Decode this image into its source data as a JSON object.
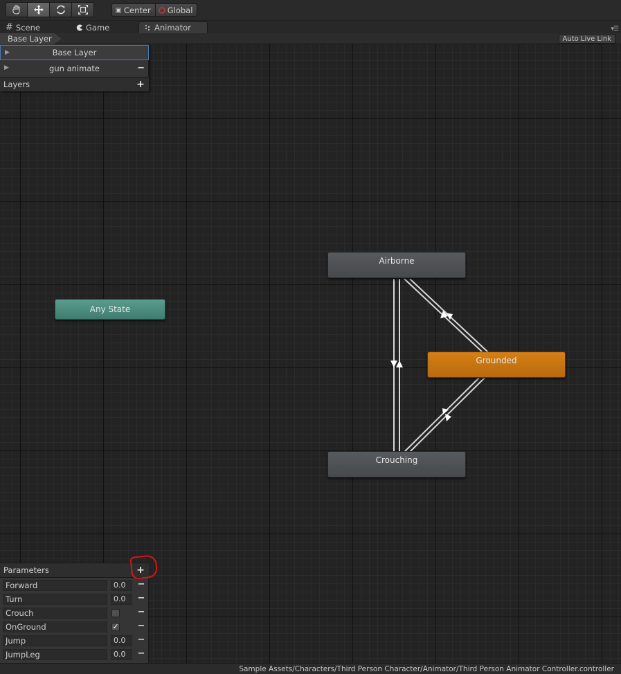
{
  "toolbar": {
    "tools": [
      {
        "name": "hand-icon",
        "glyph": "✋"
      },
      {
        "name": "move-icon",
        "glyph": "✥"
      },
      {
        "name": "rotate-icon",
        "glyph": "⟳"
      },
      {
        "name": "scale-icon",
        "glyph": "⤢"
      }
    ],
    "pivot_label": "Center",
    "space_label": "Global"
  },
  "tabs": {
    "scene": "Scene",
    "game": "Game",
    "animator": "Animator"
  },
  "breadcrumb": "Base Layer",
  "auto_live_link": "Auto Live Link",
  "layers": {
    "items": [
      {
        "label": "Base Layer",
        "selected": true
      },
      {
        "label": "gun animate",
        "selected": false
      }
    ],
    "header": "Layers"
  },
  "states": {
    "any_state": "Any State",
    "airborne": "Airborne",
    "grounded": "Grounded",
    "crouching": "Crouching"
  },
  "colors": {
    "default_state": "#d57f16",
    "any_state": "#5a9d8e",
    "state": "#575a5e",
    "annotation": "#d91414"
  },
  "parameters": {
    "header": "Parameters",
    "items": [
      {
        "name": "Forward",
        "type": "float",
        "value": "0.0"
      },
      {
        "name": "Turn",
        "type": "float",
        "value": "0.0"
      },
      {
        "name": "Crouch",
        "type": "bool",
        "checked": false
      },
      {
        "name": "OnGround",
        "type": "bool",
        "checked": true
      },
      {
        "name": "Jump",
        "type": "float",
        "value": "0.0"
      },
      {
        "name": "JumpLeg",
        "type": "float",
        "value": "0.0"
      }
    ]
  },
  "status_path": "Sample Assets/Characters/Third Person Character/Animator/Third Person Animator Controller.controller"
}
